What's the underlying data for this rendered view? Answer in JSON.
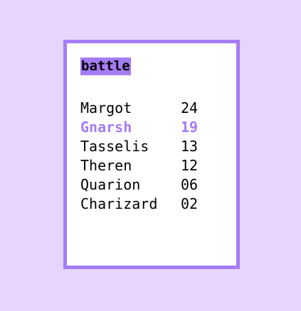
{
  "menu": {
    "title": "battle",
    "colors": {
      "background": "#e8d5fe",
      "accent": "#a57cf6",
      "panel": "#ffffff",
      "text": "#000000"
    },
    "selected_index": 1,
    "entries": [
      {
        "name": "Margot",
        "score": "24"
      },
      {
        "name": "Gnarsh",
        "score": "19"
      },
      {
        "name": "Tasselis",
        "score": "13"
      },
      {
        "name": "Theren",
        "score": "12"
      },
      {
        "name": "Quarion",
        "score": "06"
      },
      {
        "name": "Charizard",
        "score": "02"
      }
    ]
  }
}
